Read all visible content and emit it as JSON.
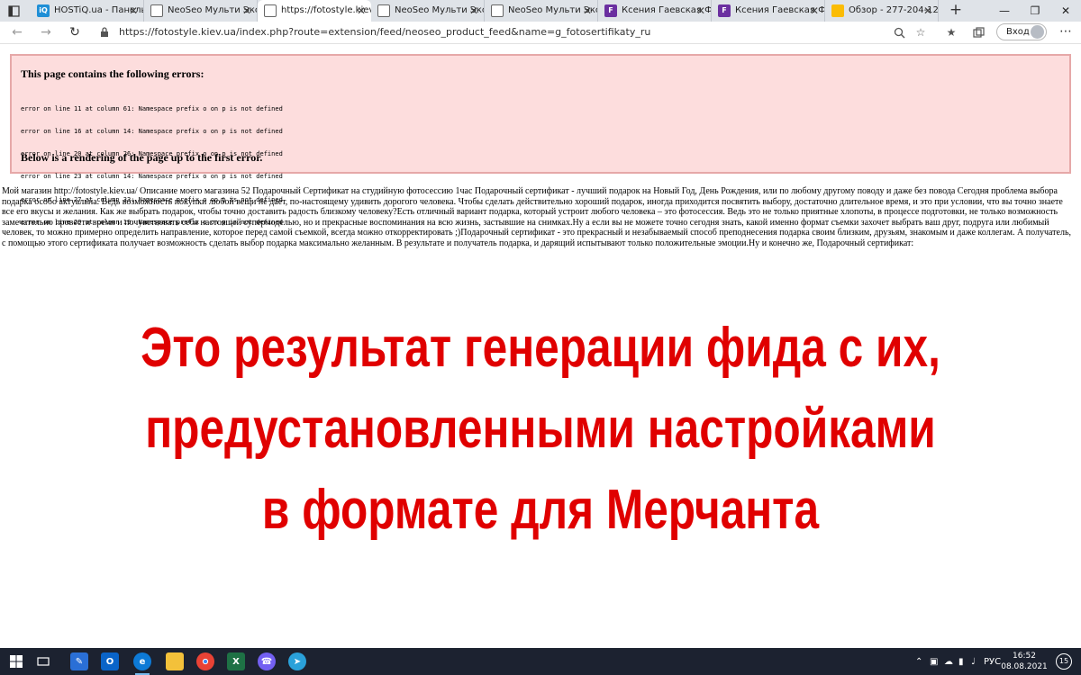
{
  "browser": {
    "tabs": [
      {
        "label": "HOSTiQ.ua - Панель",
        "favicon": "hostiq-icon",
        "color": "#1f8fd6",
        "glyph": "iQ",
        "active": false
      },
      {
        "label": "NeoSeo Мульти Эксп",
        "favicon": "page-icon",
        "color": "#ffffff",
        "glyph": "",
        "active": false
      },
      {
        "label": "https://fotostyle.kiev",
        "favicon": "page-icon",
        "color": "#ffffff",
        "glyph": "",
        "active": true
      },
      {
        "label": "NeoSeo Мульти Эксп",
        "favicon": "page-icon",
        "color": "#ffffff",
        "glyph": "",
        "active": false
      },
      {
        "label": "NeoSeo Мульти Эксп",
        "favicon": "page-icon",
        "color": "#ffffff",
        "glyph": "",
        "active": false
      },
      {
        "label": "Ксения Гаевская Фо",
        "favicon": "site-logo-icon",
        "color": "#6b2fa0",
        "glyph": "F",
        "active": false
      },
      {
        "label": "Ксения Гаевская Фо",
        "favicon": "site-logo-icon",
        "color": "#6b2fa0",
        "glyph": "F",
        "active": false
      },
      {
        "label": "Обзор - 277-204-12",
        "favicon": "google-ads-icon",
        "color": "#fbbc04",
        "glyph": "",
        "active": false
      }
    ],
    "url": "https://fotostyle.kiev.ua/index.php?route=extension/feed/neoseo_product_feed&name=g_fotosertifikaty_ru",
    "login_label": "Вход"
  },
  "error_box": {
    "heading": "This page contains the following errors:",
    "lines": [
      "error on line 11 at column 61: Namespace prefix o on p is not defined",
      "error on line 16 at column 14: Namespace prefix o on p is not defined",
      "error on line 20 at column 26: Namespace prefix o on p is not defined",
      "error on line 23 at column 14: Namespace prefix o on p is not defined",
      "error on line 27 at column 33: Namespace prefix o on p is not defined",
      "error on line 29 at column 19: Namespace prefix o on p is not defined"
    ],
    "footer": "Below is a rendering of the page up to the first error."
  },
  "feed_text": "Мой магазин http://fotostyle.kiev.ua/ Описание моего магазина 52 Подарочный Сертификат на студийную фотосессию 1час Подарочный сертификат - лучший подарок на Новый Год, День Рождения, или по любому другому поводу и даже без повода Сегодня проблема выбора подарка особо актуальна. Ведь возможность покупки любой вещи не дает, по-настоящему удивить дорогого человека. Чтобы сделать действительно хороший подарок, иногда приходится посвятить выбору, достаточно длительное время, и это при условии, что вы точно знаете все его вкусы и желания. Как же выбрать подарок, чтобы точно доставить радость близкому человеку?Есть отличный вариант подарка, который устроит любого человека – это фотосессия. Ведь это не только приятные хлопоты, в процессе подготовки, не только возможность замечательно провести время и почувствовать себя настоящей супермоделью, но и прекрасные воспоминания на всю жизнь, застывшие на снимках.Ну а если вы не можете точно сегодня знать, какой именно формат съемки захочет выбрать ваш друг, подруга или любимый человек, то можно примерно определить направление, которое перед самой съемкой, всегда можно откорректировать ;)Подарочный сертификат - это прекрасный и незабываемый способ преподнесения подарка своим близким, друзьям, знакомым и даже коллегам. А получатель, с помощью этого сертификата получает возможность сделать выбор подарка максимально желанным. В результате и получатель подарка, и дарящий испытывают только положительные эмоции.Ну и конечно же, Подарочный сертификат:",
  "caption": {
    "line1": "Это результат генерации фида с их,",
    "line2": "предустановленными настройками",
    "line3": "в формате для Мерчанта",
    "color": "#e00000"
  },
  "taskbar": {
    "lang": "РУС",
    "time": "16:52",
    "date": "08.08.2021",
    "notifications": "15"
  }
}
